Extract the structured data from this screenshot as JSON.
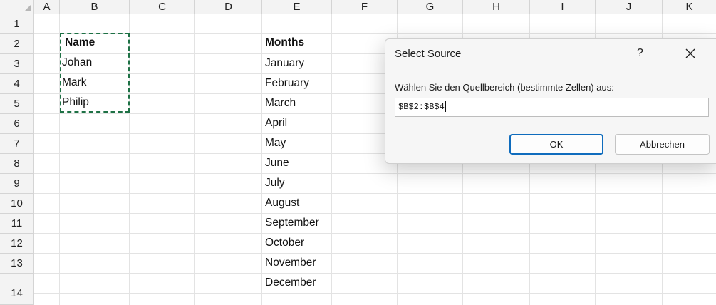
{
  "columns": [
    "A",
    "B",
    "C",
    "D",
    "E",
    "F",
    "G",
    "H",
    "I",
    "J",
    "K"
  ],
  "rows": [
    "1",
    "2",
    "3",
    "4",
    "5",
    "6",
    "7",
    "8",
    "9",
    "10",
    "11",
    "12",
    "13",
    "14"
  ],
  "cells": {
    "name_header": "Name",
    "names": [
      "Johan",
      "Mark",
      "Philip"
    ],
    "months_header": "Months",
    "months": [
      "January",
      "February",
      "March",
      "April",
      "May",
      "June",
      "July",
      "August",
      "September",
      "October",
      "November",
      "December"
    ]
  },
  "dialog": {
    "title": "Select Source",
    "help": "?",
    "prompt": "Wählen Sie den Quellbereich (bestimmte Zellen) aus:",
    "input_value": "$B$2:$B$4",
    "ok_label": "OK",
    "cancel_label": "Abbrechen"
  },
  "colors": {
    "accent": "#0f6cbd",
    "marching_ants": "#1e7145",
    "header_bg": "#f3f3f3"
  },
  "icons": {
    "close": "close-icon",
    "select_all": "select-all-icon"
  }
}
